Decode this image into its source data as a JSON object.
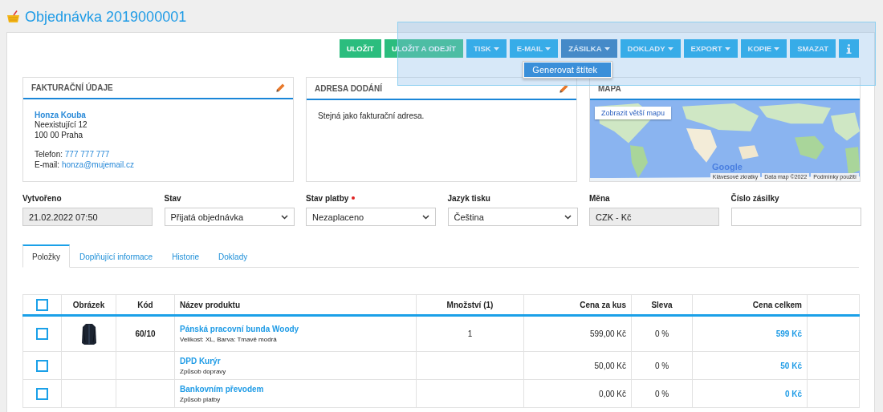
{
  "title": "Objednávka 2019000001",
  "toolbar": [
    {
      "label": "ULOŽIT",
      "kind": "green",
      "caret": false,
      "active": false
    },
    {
      "label": "ULOŽIT A ODEJÍT",
      "kind": "green",
      "caret": false,
      "active": false
    },
    {
      "label": "TISK",
      "kind": "blue",
      "caret": true,
      "active": false
    },
    {
      "label": "E-MAIL",
      "kind": "blue",
      "caret": true,
      "active": false
    },
    {
      "label": "ZÁSILKA",
      "kind": "blue",
      "caret": true,
      "active": true,
      "menu": [
        "Generovat štítek"
      ]
    },
    {
      "label": "DOKLADY",
      "kind": "blue",
      "caret": true,
      "active": false
    },
    {
      "label": "EXPORT",
      "kind": "blue",
      "caret": true,
      "active": false
    },
    {
      "label": "KOPIE",
      "kind": "blue",
      "caret": true,
      "active": false
    },
    {
      "label": "SMAZAT",
      "kind": "blue",
      "caret": false,
      "active": false
    },
    {
      "kind": "info"
    }
  ],
  "billing": {
    "title": "FAKTURAČNÍ ÚDAJE",
    "name": "Honza Kouba",
    "lines": [
      "Neexistující 12",
      "100 00 Praha"
    ],
    "phone_label": "Telefon:",
    "phone": "777 777 777",
    "email_label": "E-mail:",
    "email": "honza@mujemail.cz"
  },
  "delivery": {
    "title": "ADRESA DODÁNÍ",
    "text": "Stejná jako fakturační adresa."
  },
  "map": {
    "title": "MAPA",
    "button": "Zobrazit větší mapu",
    "logo": "Google",
    "attribution": [
      "Klávesové zkratky",
      "Data map ©2022",
      "Podmínky použití"
    ]
  },
  "fields": [
    {
      "label": "Vytvořeno",
      "kind": "readonly",
      "value": "21.02.2022 07:50",
      "required": false
    },
    {
      "label": "Stav",
      "kind": "select",
      "value": "Přijatá objednávka",
      "required": false
    },
    {
      "label": "Stav platby",
      "kind": "select",
      "value": "Nezaplaceno",
      "required": true
    },
    {
      "label": "Jazyk tisku",
      "kind": "select",
      "value": "Čeština",
      "required": false
    },
    {
      "label": "Měna",
      "kind": "readonly",
      "value": "CZK - Kč",
      "required": false
    },
    {
      "label": "Číslo zásilky",
      "kind": "input",
      "required": false
    }
  ],
  "tabs": [
    {
      "label": "Položky",
      "selected": true
    },
    {
      "label": "Doplňující informace",
      "selected": false
    },
    {
      "label": "Historie",
      "selected": false
    },
    {
      "label": "Doklady",
      "selected": false
    }
  ],
  "table": {
    "header_checked": false,
    "columns": [
      "Obrázek",
      "Kód",
      "Název produktu",
      "Množství (1)",
      "Cena za kus",
      "Sleva",
      "Cena celkem"
    ],
    "rows": [
      {
        "checked": false,
        "image": true,
        "code": "60/10",
        "name": "Pánská pracovní bunda Woody",
        "detail": "Velikost: XL, Barva: Tmavě modrá",
        "qty": "1",
        "price": "599,00 Kč",
        "discount": "0 %",
        "total": "599 Kč"
      },
      {
        "checked": false,
        "image": false,
        "name": "DPD Kurýr",
        "detail": "Způsob dopravy",
        "price": "50,00 Kč",
        "discount": "0 %",
        "total": "50 Kč"
      },
      {
        "checked": false,
        "image": false,
        "name": "Bankovním převodem",
        "detail": "Způsob platby",
        "price": "0,00 Kč",
        "discount": "0 %",
        "total": "0 Kč"
      }
    ]
  }
}
